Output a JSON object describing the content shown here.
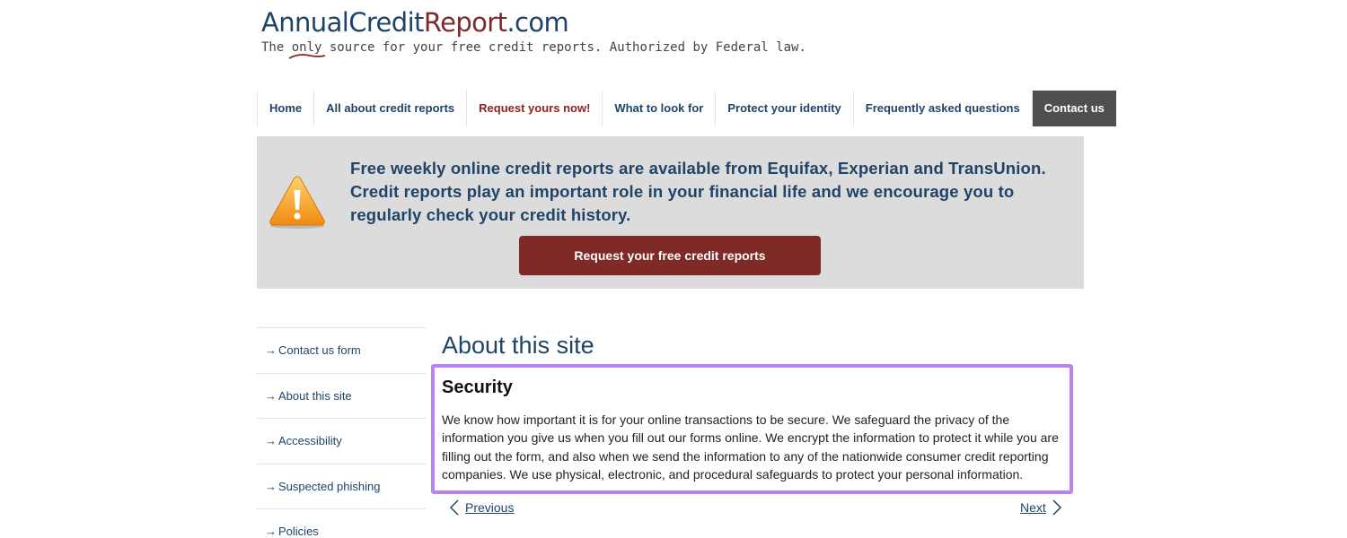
{
  "logo": {
    "annual": "Annual",
    "credit": "Credit",
    "report": "Report",
    "dotcom": ".com",
    "tagline_before": "The ",
    "tagline_only": "only",
    "tagline_after": " source for your free credit reports. Authorized by Federal law."
  },
  "nav": {
    "items": [
      {
        "label": "Home"
      },
      {
        "label": "All about credit reports"
      },
      {
        "label": "Request yours now!"
      },
      {
        "label": "What to look for"
      },
      {
        "label": "Protect your identity"
      },
      {
        "label": "Frequently asked questions"
      },
      {
        "label": "Contact us"
      }
    ]
  },
  "banner": {
    "icon": "warning-icon",
    "text": "Free weekly online credit reports are available from Equifax, Experian and TransUnion. Credit reports play an important role in your financial life and we encourage you to regularly check your credit history.",
    "button_label": "Request your free credit reports"
  },
  "sidebar": {
    "items": [
      {
        "label": "Contact us form"
      },
      {
        "label": "About this site"
      },
      {
        "label": "Accessibility"
      },
      {
        "label": "Suspected phishing"
      },
      {
        "label": "Policies"
      }
    ],
    "arrow": "→"
  },
  "main": {
    "title": "About this site",
    "section_heading": "Security",
    "section_body": "We know how important it is for your online transactions to be secure. We safeguard the privacy of the information you give us when you fill out our forms online. We encrypt the information to protect it while you are filling out the form, and also when we send the information to any of the nationwide consumer credit reporting companies. We use physical, electronic, and procedural safeguards to protect your personal information.",
    "prev_label": "Previous",
    "next_label": "Next"
  },
  "colors": {
    "brand_blue": "#1f4468",
    "brand_red": "#7f2a27",
    "highlight": "#b784f0",
    "nav_active": "#4f4f4f"
  }
}
